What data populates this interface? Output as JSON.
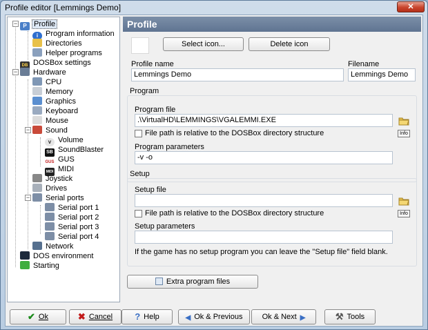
{
  "window": {
    "title": "Profile editor [Lemmings Demo]",
    "close_glyph": "✕"
  },
  "tree": {
    "items": [
      {
        "label": "Profile",
        "icon": "profile-icon"
      },
      {
        "label": "Program information",
        "icon": "info-icon"
      },
      {
        "label": "Directories",
        "icon": "folder-icon"
      },
      {
        "label": "Helper programs",
        "icon": "helper-icon"
      },
      {
        "label": "DOSBox settings",
        "icon": "dosbox-icon"
      },
      {
        "label": "Hardware",
        "icon": "hardware-icon"
      },
      {
        "label": "CPU",
        "icon": "cpu-icon"
      },
      {
        "label": "Memory",
        "icon": "memory-icon"
      },
      {
        "label": "Graphics",
        "icon": "graphics-icon"
      },
      {
        "label": "Keyboard",
        "icon": "keyboard-icon"
      },
      {
        "label": "Mouse",
        "icon": "mouse-icon"
      },
      {
        "label": "Sound",
        "icon": "sound-icon"
      },
      {
        "label": "Volume",
        "icon": "volume-icon"
      },
      {
        "label": "SoundBlaster",
        "icon": "soundblaster-icon"
      },
      {
        "label": "GUS",
        "icon": "gus-icon"
      },
      {
        "label": "MIDI",
        "icon": "midi-icon"
      },
      {
        "label": "Joystick",
        "icon": "joystick-icon"
      },
      {
        "label": "Drives",
        "icon": "drives-icon"
      },
      {
        "label": "Serial ports",
        "icon": "serial-icon"
      },
      {
        "label": "Serial port 1",
        "icon": "serial-port-icon"
      },
      {
        "label": "Serial port 2",
        "icon": "serial-port-icon"
      },
      {
        "label": "Serial port 3",
        "icon": "serial-port-icon"
      },
      {
        "label": "Serial port 4",
        "icon": "serial-port-icon"
      },
      {
        "label": "Network",
        "icon": "network-icon"
      },
      {
        "label": "DOS environment",
        "icon": "dos-icon"
      },
      {
        "label": "Starting",
        "icon": "starting-icon"
      }
    ]
  },
  "panel": {
    "title": "Profile",
    "select_icon": "Select icon...",
    "delete_icon": "Delete icon",
    "profile_name_label": "Profile name",
    "profile_name": "Lemmings Demo",
    "filename_label": "Filename",
    "filename": "Lemmings Demo",
    "program_group": "Program",
    "program_file_label": "Program file",
    "program_file": ".\\VirtualHD\\LEMMINGS\\VGALEMMI.EXE",
    "relative_label": "File path is relative to the DOSBox directory structure",
    "info_label": "Info",
    "program_params_label": "Program parameters",
    "program_params": "-v -o",
    "setup_group": "Setup",
    "setup_file_label": "Setup file",
    "setup_file": "",
    "setup_relative_label": "File path is relative to the DOSBox directory structure",
    "setup_params_label": "Setup parameters",
    "setup_params": "",
    "setup_hint": "If the game has no setup program you can leave the \"Setup file\" field blank.",
    "extra_files": "Extra program files"
  },
  "buttons": {
    "ok": "Ok",
    "cancel": "Cancel",
    "help": "Help",
    "ok_previous": "Ok & Previous",
    "ok_next": "Ok & Next",
    "tools": "Tools"
  },
  "colors": {
    "ok_check": "#1a8a1a",
    "cancel_x": "#c21a1a",
    "accent": "#3a6fc4"
  }
}
